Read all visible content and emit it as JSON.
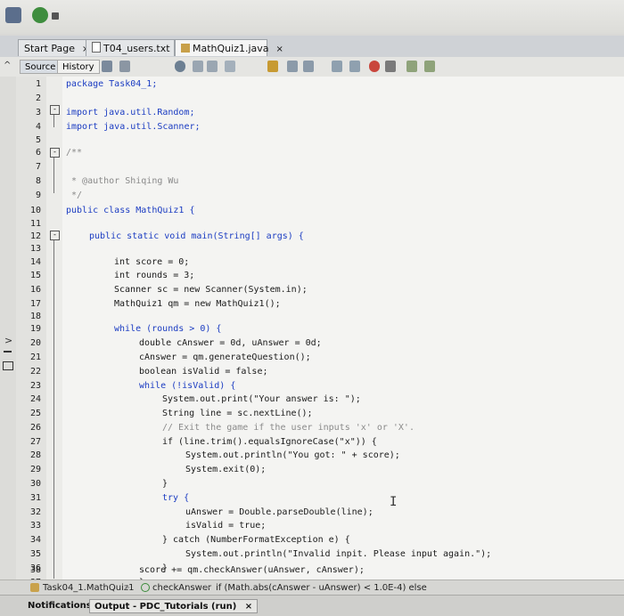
{
  "tabs": [
    {
      "label": "Start Page",
      "close": "×"
    },
    {
      "label": "T04_users.txt",
      "close": "×"
    },
    {
      "label": "MathQuiz1.java",
      "close": "×"
    }
  ],
  "toolbar": {
    "source_label": "Source",
    "history_label": "History"
  },
  "line_numbers": [
    "1",
    "2",
    "3",
    "4",
    "5",
    "6",
    "7",
    "8",
    "9",
    "10",
    "11",
    "12",
    "13",
    "14",
    "15",
    "16",
    "17",
    "18",
    "19",
    "20",
    "21",
    "22",
    "23",
    "24",
    "25",
    "26",
    "27",
    "28",
    "29",
    "30",
    "31",
    "32",
    "33",
    "34",
    "35",
    "36",
    "37",
    "38"
  ],
  "code": {
    "l1": "package Task04_1;",
    "l3": "import java.util.Random;",
    "l4": "import java.util.Scanner;",
    "l6": "/**",
    "l8": " * @author Shiqing Wu",
    "l9": " */",
    "l10": "public class MathQuiz1 {",
    "l12": "public static void main(String[] args) {",
    "l14": "int score = 0;",
    "l15": "int rounds = 3;",
    "l16": "Scanner sc = new Scanner(System.in);",
    "l17": "MathQuiz1 qm = new MathQuiz1();",
    "l19": "while (rounds > 0) {",
    "l20": "double cAnswer = 0d, uAnswer = 0d;",
    "l21": "cAnswer = qm.generateQuestion();",
    "l22": "boolean isValid = false;",
    "l23": "while (!isValid) {",
    "l24": "System.out.print(\"Your answer is: \");",
    "l25": "String line = sc.nextLine();",
    "l26": "// Exit the game if the user inputs 'x' or 'X'.",
    "l27": "if (line.trim().equalsIgnoreCase(\"x\")) {",
    "l28": "System.out.println(\"You got: \" + score);",
    "l29": "System.exit(0);",
    "l30": "}",
    "l31": "try {",
    "l32": "uAnswer = Double.parseDouble(line);",
    "l33": "isValid = true;",
    "l34": "} catch (NumberFormatException e) {",
    "l35": "System.out.println(\"Invalid inpit. Please input again.\");",
    "l36": "}",
    "l37": "}",
    "l38": "score += qm.checkAnswer(uAnswer, cAnswer);"
  },
  "breadcrumbs": [
    "Task04_1.MathQuiz1",
    "checkAnswer",
    "if (Math.abs(cAnswer - uAnswer) < 1.0E-4) else"
  ],
  "bottom_tabs": {
    "notifications": "Notifications",
    "output": "Output - PDC_Tutorials (run)",
    "output_close": "×"
  },
  "colors": {
    "keyword": "#1b3cc2",
    "comment": "#8a8a8a",
    "string": "#b55a1a"
  }
}
